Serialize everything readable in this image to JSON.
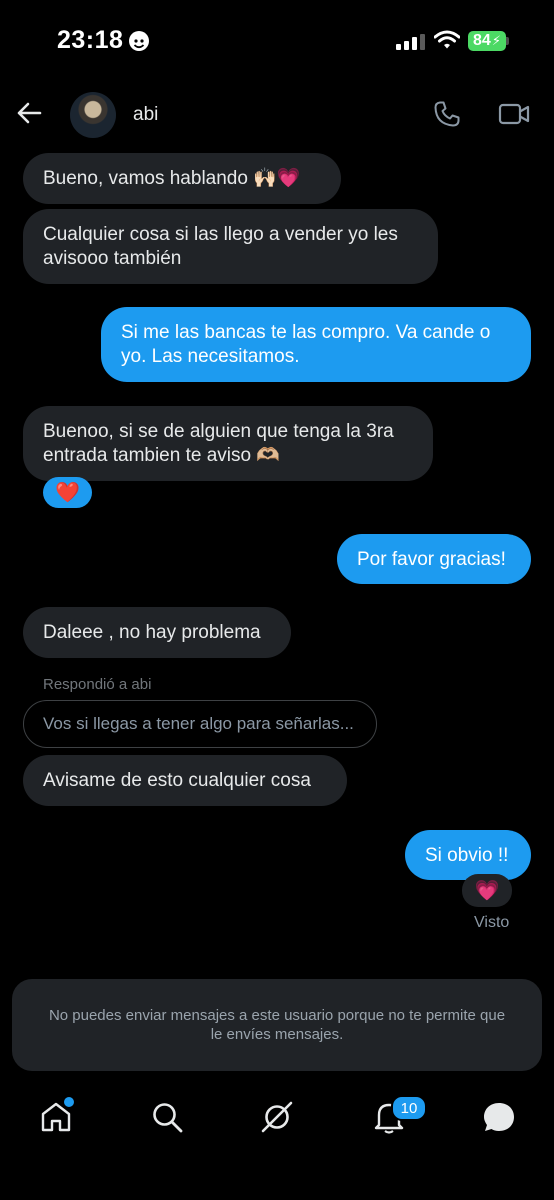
{
  "status_bar": {
    "time": "23:18",
    "battery": "84"
  },
  "header": {
    "contact_name": "abi"
  },
  "messages": {
    "m1": "Bueno, vamos hablando 🙌🏻💗",
    "m2": "Cualquier cosa si las llego a vender yo les avisooo también",
    "m3": "Si me las bancas te las compro. Va cande o yo. Las necesitamos.",
    "m4": "Buenoo, si se de alguien que tenga la 3ra entrada tambien te aviso 🫶🏼",
    "m4_reaction": "❤️",
    "m5": "Por favor gracias!",
    "m6": "Daleee , no hay problema",
    "reply_label": "Respondió a abi",
    "reply_quote": "Vos si llegas a tener algo para señarlas...",
    "m7": "Avisame de esto cualquier cosa",
    "m8": "Si obvio !!",
    "m8_reaction": "💗",
    "seen": "Visto"
  },
  "notice": "No puedes enviar mensajes a este usuario porque no te permite que le envíes mensajes.",
  "nav": {
    "notifications_count": "10"
  },
  "colors": {
    "accent": "#1d9bf0",
    "received_bubble": "#202327",
    "background": "#000000"
  },
  "icons": [
    "back-arrow-icon",
    "phone-icon",
    "video-icon",
    "home-icon",
    "search-icon",
    "grok-icon",
    "bell-icon",
    "messages-icon"
  ]
}
